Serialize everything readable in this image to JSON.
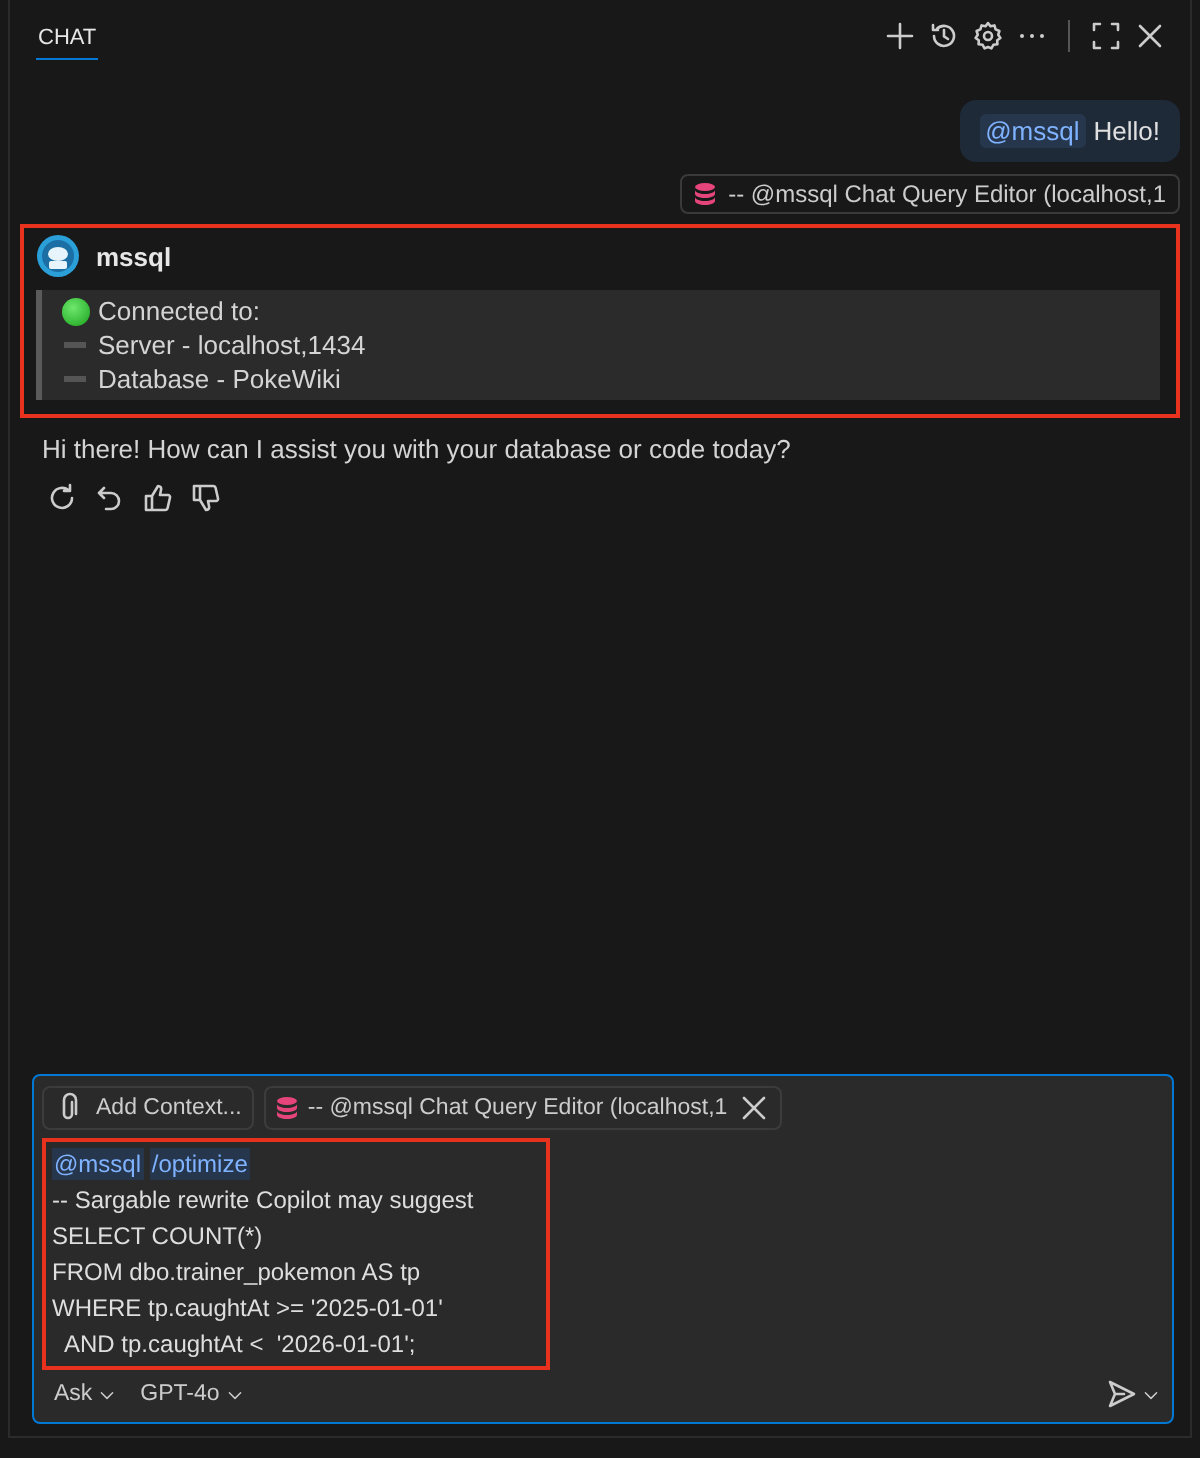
{
  "header": {
    "tabs": [
      {
        "label": "CHAT",
        "selected": true
      }
    ]
  },
  "messages": [
    {
      "kind": "user",
      "mention": "@mssql",
      "text": "Hello!",
      "reference": "-- @mssql Chat Query Editor (localhost,1"
    },
    {
      "kind": "assistant",
      "author": "mssql",
      "highlighted": true,
      "connection": [
        {
          "kind": "status",
          "text": "Connected to:"
        },
        {
          "kind": "item",
          "text": "Server - localhost,1434"
        },
        {
          "kind": "item",
          "text": "Database - PokeWiki"
        }
      ],
      "reply": "Hi there! How can I assist you with your database or code today?"
    }
  ],
  "input": {
    "context_button": "Add Context...",
    "attachment": "-- @mssql Chat Query Editor (localhost,1",
    "highlighted": true,
    "mention": "@mssql",
    "command": "/optimize",
    "lines": [
      "-- Sargable rewrite Copilot may suggest",
      "SELECT COUNT(*)",
      "FROM dbo.trainer_pokemon AS tp",
      "WHERE tp.caughtAt >= '2025-01-01'",
      "  AND tp.caughtAt <  '2026-01-01';"
    ],
    "mode": "Ask",
    "model": "GPT-4o"
  }
}
